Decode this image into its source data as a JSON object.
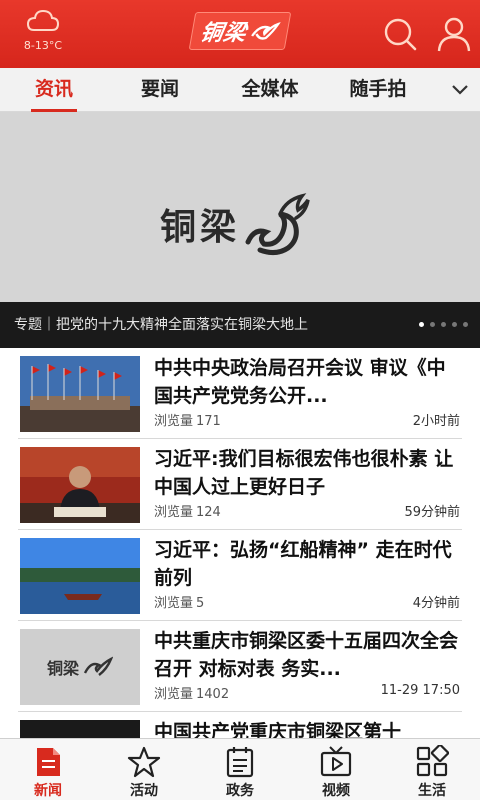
{
  "header": {
    "weather_temp": "8-13°C",
    "logo_text": "铜梁",
    "colors": {
      "brand_red": "#d6261c"
    }
  },
  "tabs": [
    {
      "label": "资讯",
      "active": true
    },
    {
      "label": "要闻",
      "active": false
    },
    {
      "label": "全媒体",
      "active": false
    },
    {
      "label": "随手拍",
      "active": false
    }
  ],
  "banner": {
    "logo_text": "铜梁",
    "caption": "专题｜把党的十九大精神全面落实在铜梁大地上",
    "slide_count": 5,
    "active_slide": 1
  },
  "news": [
    {
      "title": "中共中央政治局召开会议 审议《中国共产党党务公开...",
      "views_label": "浏览量",
      "views": "171",
      "time": "2小时前",
      "thumb": "flags"
    },
    {
      "title": "习近平:我们目标很宏伟也很朴素 让中国人过上更好日子",
      "views_label": "浏览量",
      "views": "124",
      "time": "59分钟前",
      "thumb": "speaker"
    },
    {
      "title": "习近平：弘扬“红船精神” 走在时代前列",
      "views_label": "浏览量",
      "views": "5",
      "time": "4分钟前",
      "thumb": "lake"
    },
    {
      "title": "中共重庆市铜梁区委十五届四次全会召开 对标对表 务实...",
      "views_label": "浏览量",
      "views": "1402",
      "time": "11-29 17:50",
      "thumb": "logo",
      "thumb_logo_text": "铜梁"
    },
    {
      "title": "中国共产党重庆市铜梁区第十",
      "views_label": "",
      "views": "",
      "time": "",
      "thumb": "dark"
    }
  ],
  "bottom_nav": [
    {
      "label": "新闻",
      "icon": "news-icon",
      "active": true
    },
    {
      "label": "活动",
      "icon": "star-icon",
      "active": false
    },
    {
      "label": "政务",
      "icon": "document-icon",
      "active": false
    },
    {
      "label": "视频",
      "icon": "tv-icon",
      "active": false
    },
    {
      "label": "生活",
      "icon": "grid-icon",
      "active": false
    }
  ]
}
